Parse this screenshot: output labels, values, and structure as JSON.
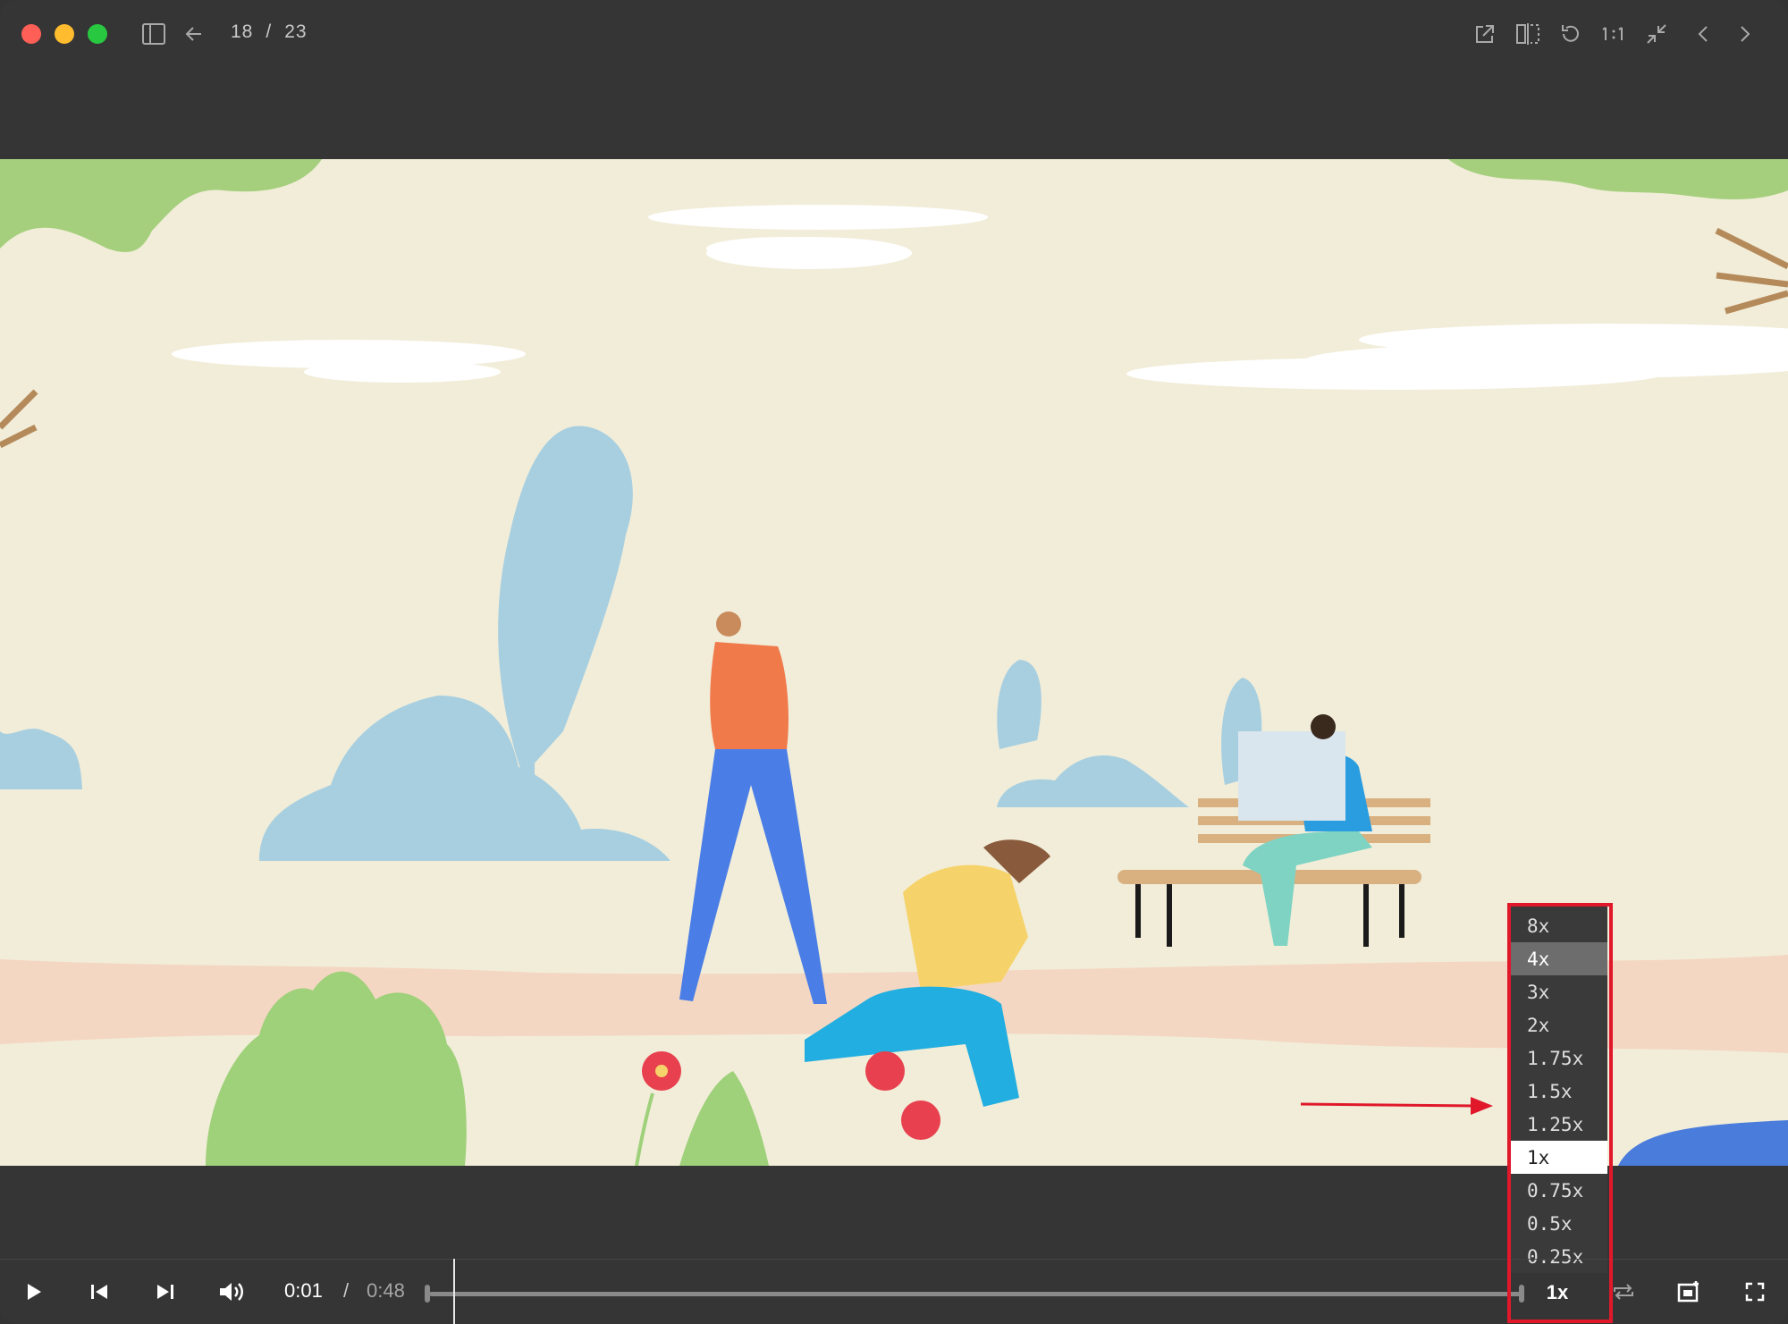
{
  "titlebar": {
    "current": "18",
    "separator": "/",
    "total": "23"
  },
  "toolbar_icons": [
    "sidebar-icon",
    "back-arrow-icon",
    "open-external-icon",
    "compare-icon",
    "rotate-icon",
    "actual-size-icon",
    "shrink-icon",
    "previous-icon",
    "next-icon"
  ],
  "player": {
    "current_time": "0:01",
    "time_separator": "/",
    "duration": "0:48",
    "speed": "1x",
    "speed_options": [
      "8x",
      "4x",
      "3x",
      "2x",
      "1.75x",
      "1.5x",
      "1.25x",
      "1x",
      "0.75x",
      "0.5x",
      "0.25x"
    ],
    "hover_option": "4x",
    "selected_option": "1x"
  },
  "colors": {
    "accent_red": "#e0182a",
    "background": "#353535",
    "scene_bg": "#f1edd9"
  }
}
